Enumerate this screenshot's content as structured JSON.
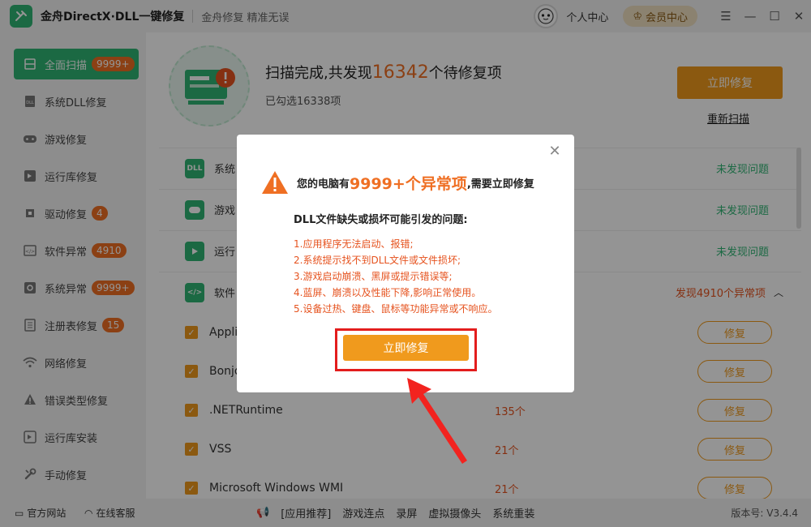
{
  "app": {
    "title": "金舟DirectX·DLL一键修复",
    "slogan": "金舟修复 精准无误",
    "personal_center": "个人中心",
    "vip_center": "会员中心"
  },
  "sidebar": {
    "items": [
      {
        "label": "全面扫描",
        "badge": "9999+"
      },
      {
        "label": "系统DLL修复",
        "badge": ""
      },
      {
        "label": "游戏修复",
        "badge": ""
      },
      {
        "label": "运行库修复",
        "badge": ""
      },
      {
        "label": "驱动修复",
        "badge": "4"
      },
      {
        "label": "软件异常",
        "badge": "4910"
      },
      {
        "label": "系统异常",
        "badge": "9999+"
      },
      {
        "label": "注册表修复",
        "badge": "15"
      },
      {
        "label": "网络修复",
        "badge": ""
      },
      {
        "label": "错误类型修复",
        "badge": ""
      },
      {
        "label": "运行库安装",
        "badge": ""
      },
      {
        "label": "手动修复",
        "badge": ""
      }
    ]
  },
  "scan": {
    "title_prefix": "扫描完成,共发现",
    "count": "16342",
    "title_suffix": "个待修复项",
    "selected": "已勾选16338项",
    "fix_button": "立即修复",
    "rescan": "重新扫描"
  },
  "list": {
    "categories": [
      {
        "name": "系统",
        "status": "未发现问题",
        "icon": "DLL"
      },
      {
        "name": "游戏",
        "status": "未发现问题",
        "icon": ""
      },
      {
        "name": "运行",
        "status": "未发现问题",
        "icon": ""
      },
      {
        "name": "软件",
        "status": "发现4910个异常项",
        "icon": ""
      }
    ],
    "items": [
      {
        "name": "Appli",
        "count": "",
        "action": "修复"
      },
      {
        "name": "Bonjo",
        "count": "",
        "action": "修复"
      },
      {
        "name": ".NETRuntime",
        "count": "135个",
        "action": "修复"
      },
      {
        "name": "VSS",
        "count": "21个",
        "action": "修复"
      },
      {
        "name": "Microsoft Windows WMI",
        "count": "21个",
        "action": "修复"
      }
    ]
  },
  "dialog": {
    "head_prefix": "您的电脑有",
    "head_count": "9999+个异常项",
    "head_suffix": ",需要立即修复",
    "subtitle": "DLL文件缺失或损坏可能引发的问题:",
    "issues": [
      "1.应用程序无法启动、报错;",
      "2.系统提示找不到DLL文件或文件损坏;",
      "3.游戏启动崩溃、黑屏或提示错误等;",
      "4.蓝屏、崩溃以及性能下降,影响正常使用。",
      "5.设备过热、键盘、鼠标等功能异常或不响应。"
    ],
    "fix_button": "立即修复"
  },
  "footer": {
    "website": "官方网站",
    "support": "在线客服",
    "recommend": "[应用推荐]",
    "links": [
      "游戏连点",
      "录屏",
      "虚拟摄像头",
      "系统重装"
    ],
    "version": "版本号: V3.4.4"
  },
  "colors": {
    "brand_green": "#2fb574",
    "accent_orange": "#f09a1d",
    "warn_red": "#e6531f"
  }
}
